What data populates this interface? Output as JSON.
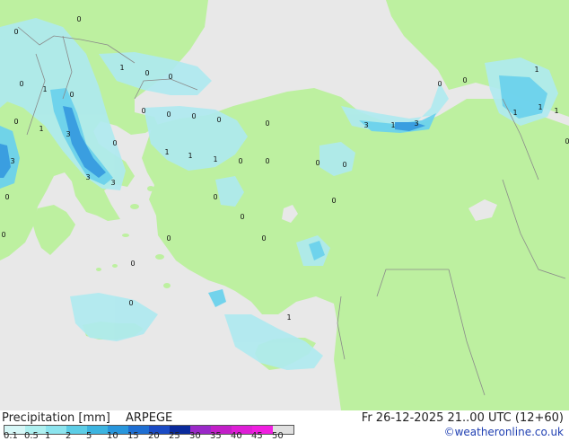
{
  "footer": {
    "title": "Precipitation [mm]",
    "model": "ARPEGE",
    "valid": "Fr 26-12-2025 21..00 UTC (12+60)",
    "credit": "©weatheronline.co.uk"
  },
  "legend": {
    "labels": [
      "0.1",
      "0.5",
      "1",
      "2",
      "5",
      "10",
      "15",
      "20",
      "25",
      "30",
      "35",
      "40",
      "45",
      "50"
    ],
    "colors": [
      "#d6f7f7",
      "#aef0f0",
      "#8ce4ee",
      "#5ccde6",
      "#3cb4e0",
      "#2896dc",
      "#1e6ed2",
      "#1a4ac4",
      "#0a2a9c",
      "#9a28c8",
      "#c21ec8",
      "#de1ed6",
      "#f01ee0",
      "#e0e0e0"
    ]
  },
  "map": {
    "colors": {
      "sea": "#e8e8e8",
      "land": "#bdf0a0",
      "light_precip": "#aeeaf0",
      "mid_precip": "#6cd2ec",
      "heavy_precip": "#3a9ee0",
      "border": "#8a8a8a"
    },
    "point_values": [
      {
        "label": "0"
      },
      {
        "label": "0"
      },
      {
        "label": "1"
      },
      {
        "label": "0"
      },
      {
        "label": "1"
      },
      {
        "label": "0"
      },
      {
        "label": "0"
      },
      {
        "label": "0"
      },
      {
        "label": "0"
      },
      {
        "label": "1"
      },
      {
        "label": "3"
      },
      {
        "label": "0"
      },
      {
        "label": "0"
      },
      {
        "label": "0"
      },
      {
        "label": "0"
      },
      {
        "label": "0"
      },
      {
        "label": "0"
      },
      {
        "label": "1"
      },
      {
        "label": "1"
      },
      {
        "label": "1"
      },
      {
        "label": "0"
      },
      {
        "label": "0"
      },
      {
        "label": "3"
      },
      {
        "label": "3"
      },
      {
        "label": "3"
      },
      {
        "label": "0"
      },
      {
        "label": "0"
      },
      {
        "label": "0"
      },
      {
        "label": "0"
      },
      {
        "label": "0"
      },
      {
        "label": "0"
      },
      {
        "label": "0"
      },
      {
        "label": "3"
      },
      {
        "label": "1"
      },
      {
        "label": "3"
      },
      {
        "label": "0"
      },
      {
        "label": "0"
      },
      {
        "label": "1"
      },
      {
        "label": "1"
      },
      {
        "label": "1"
      },
      {
        "label": "1"
      },
      {
        "label": "0"
      },
      {
        "label": "0"
      },
      {
        "label": "0"
      },
      {
        "label": "0"
      },
      {
        "label": "0"
      },
      {
        "label": "1"
      }
    ]
  }
}
